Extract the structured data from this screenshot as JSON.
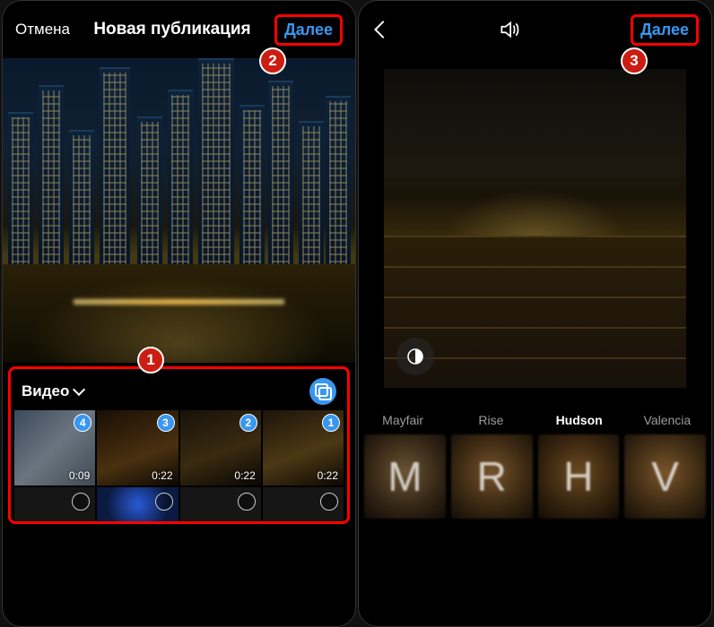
{
  "left": {
    "cancel": "Отмена",
    "title": "Новая публикация",
    "next": "Далее",
    "gallery_label": "Видео",
    "thumbs": [
      {
        "order": "4",
        "dur": "0:09"
      },
      {
        "order": "3",
        "dur": "0:22"
      },
      {
        "order": "2",
        "dur": "0:22"
      },
      {
        "order": "1",
        "dur": "0:22"
      }
    ]
  },
  "right": {
    "next": "Далее",
    "filters": [
      {
        "name": "Mayfair",
        "letter": "M",
        "selected": false
      },
      {
        "name": "Rise",
        "letter": "R",
        "selected": false
      },
      {
        "name": "Hudson",
        "letter": "H",
        "selected": true
      },
      {
        "name": "Valencia",
        "letter": "V",
        "selected": false
      }
    ]
  },
  "steps": {
    "s1": "1",
    "s2": "2",
    "s3": "3"
  }
}
